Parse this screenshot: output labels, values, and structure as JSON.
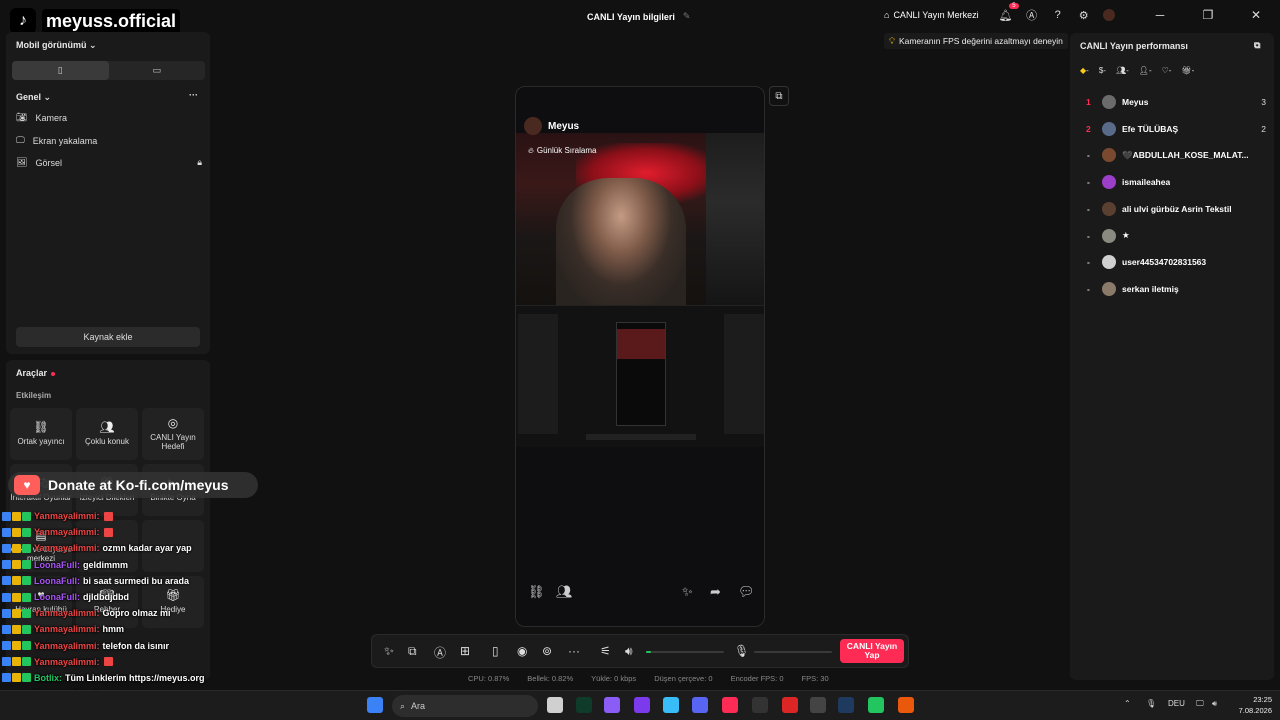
{
  "header": {
    "logo_text": "meyuss.official",
    "title": "CANLI Yayın bilgileri",
    "live_center": "CANLI Yayın Merkezi",
    "notification_count": "5"
  },
  "tip": "Kameranın FPS değerini azaltmayı deneyin",
  "left": {
    "mobile_view": "Mobil görünümü",
    "general": "Genel",
    "sources": [
      "Kamera",
      "Ekran yakalama",
      "Görsel"
    ],
    "add_source": "Kaynak ekle",
    "tools_title": "Araçlar",
    "engagement": "Etkileşim",
    "tools": [
      {
        "label": "Ortak yayıncı",
        "icon": "link-icon"
      },
      {
        "label": "Çoklu konuk",
        "icon": "users-icon"
      },
      {
        "label": "CANLI Yayın Hedefi",
        "icon": "target-icon"
      },
      {
        "label": "İnteraktif Oyunlar",
        "icon": "game-icon"
      },
      {
        "label": "İzleyici Dilekleri",
        "icon": "wish-icon"
      },
      {
        "label": "Birlikte Oyna",
        "icon": "play-icon"
      },
      {
        "label": "Anket ve büyüme merkezi",
        "icon": "poll-icon"
      },
      {
        "label": "",
        "icon": "blank-icon"
      },
      {
        "label": "",
        "icon": "blank-icon"
      },
      {
        "label": "Hayran kulübü",
        "icon": "fan-icon"
      },
      {
        "label": "Rehber",
        "icon": "guide-icon"
      },
      {
        "label": "Hediye",
        "icon": "gift-icon"
      }
    ]
  },
  "overlay": {
    "donate": "Donate at Ko-fi.com/meyus",
    "chat": [
      {
        "user": "Yanmayalimmi:",
        "msg": "",
        "color": "#ef4444"
      },
      {
        "user": "Yanmayalimmi:",
        "msg": "",
        "color": "#ef4444"
      },
      {
        "user": "Yanmayalimmi:",
        "msg": "ozmn kadar ayar yap",
        "color": "#ef4444"
      },
      {
        "user": "LoonaFull:",
        "msg": "geldimmm",
        "color": "#a855f7"
      },
      {
        "user": "LoonaFull:",
        "msg": "bi saat surmedi bu arada",
        "color": "#a855f7"
      },
      {
        "user": "LoonaFull:",
        "msg": "djldbdjdbd",
        "color": "#a855f7"
      },
      {
        "user": "Yanmayalimmi:",
        "msg": "Gopro olmaz mı",
        "color": "#ef4444"
      },
      {
        "user": "Yanmayalimmi:",
        "msg": "hmm",
        "color": "#ef4444"
      },
      {
        "user": "Yanmayalimmi:",
        "msg": "telefon da isınır",
        "color": "#ef4444"
      },
      {
        "user": "Yanmayalimmi:",
        "msg": "",
        "color": "#ef4444"
      },
      {
        "user": "Botlix:",
        "msg": "Tüm Linklerim https://meyus.org",
        "color": "#22c55e"
      },
      {
        "user": "Yanmayalimmi:",
        "msg": "",
        "color": "#ef4444"
      },
      {
        "user": "Yanmayalimmi:",
        "msg": "",
        "color": "#ef4444"
      }
    ]
  },
  "preview": {
    "streamer": "Meyus",
    "ranking": "Günlük Sıralama"
  },
  "controls": {
    "go_live": "CANLI Yayın Yap",
    "volume": 0.06,
    "mic": 0.0
  },
  "stats": {
    "cpu": "CPU: 0.87%",
    "memory": "Bellek: 0.82%",
    "upload": "Yükle: 0 kbps",
    "dropped": "Düşen çerçeve: 0",
    "encoder_fps": "Encoder FPS: 0",
    "fps": "FPS: 30"
  },
  "right": {
    "title": "CANLI Yayın performansı",
    "filters": [
      "-",
      "-",
      "-",
      "-",
      "-",
      "-"
    ],
    "viewers": [
      {
        "rank": "1",
        "name": "Meyus",
        "count": "3",
        "avatar_color": "#6b6b6b"
      },
      {
        "rank": "2",
        "name": "Efe TÜLÜBAŞ",
        "count": "2",
        "avatar_color": "#5a6b8a"
      },
      {
        "rank": "-",
        "name": "🖤ABDULLAH_KOSE_MALAT...",
        "count": "",
        "avatar_color": "#7a4a30"
      },
      {
        "rank": "-",
        "name": "ismaileahea",
        "count": "",
        "avatar_color": "#9b3fc9"
      },
      {
        "rank": "-",
        "name": "ali ulvi gürbüz Asrin Tekstil",
        "count": "",
        "avatar_color": "#5a4030"
      },
      {
        "rank": "-",
        "name": "★",
        "count": "",
        "avatar_color": "#8a8a80"
      },
      {
        "rank": "-",
        "name": "user44534702831563",
        "count": "",
        "avatar_color": "#d0d0d0"
      },
      {
        "rank": "-",
        "name": "serkan iletmiş",
        "count": "",
        "avatar_color": "#8a7a6a"
      }
    ]
  },
  "taskbar": {
    "search": "Ara",
    "lang": "DEU",
    "time": "23:25",
    "date": "7.08.2026"
  }
}
